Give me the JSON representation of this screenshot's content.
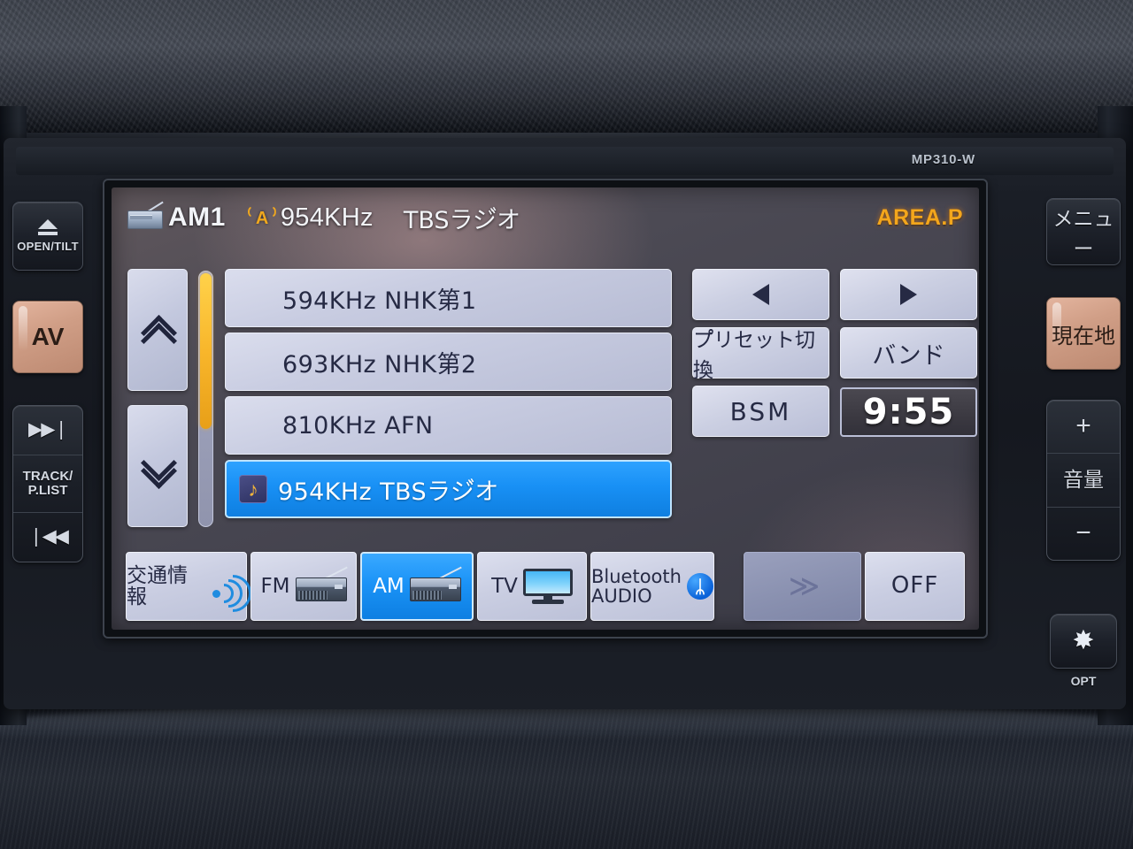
{
  "unit": {
    "model": "MP310-W"
  },
  "left_bezel": {
    "open_tilt": "OPEN/TILT",
    "av": "AV",
    "next_track": "▶▶❘",
    "track_plist_line1": "TRACK/",
    "track_plist_line2": "P.LIST",
    "prev_track": "❘◀◀"
  },
  "right_bezel": {
    "menu": "メニュー",
    "current_location": "現在地",
    "volume_up": "+",
    "volume_label": "音量",
    "volume_down": "−",
    "opt_label": "OPT",
    "opt_glyph": "✸"
  },
  "header": {
    "radio_icon": "radio-icon",
    "band": "AM1",
    "antenna_icon": "antenna-icon",
    "antenna_letter": "A",
    "frequency": "954KHz",
    "station": "TBSラジ゙オ",
    "area_preset": "AREA.P",
    "area_color": "#f3a61c"
  },
  "presets": {
    "scroll_up_icon": "chevron-up-icon",
    "scroll_down_icon": "chevron-down-icon",
    "items": [
      {
        "label": "594KHz  NHK第1",
        "selected": false
      },
      {
        "label": "693KHz  NHK第2",
        "selected": false
      },
      {
        "label": "810KHz  AFN",
        "selected": false
      },
      {
        "label": "954KHz  TBSラジ゙オ",
        "selected": true,
        "icon": "music-note-icon",
        "icon_glyph": "♪"
      }
    ]
  },
  "controls": {
    "prev_arrow": "◀",
    "next_arrow": "▶",
    "preset_switch": "プ゚リセット切換",
    "band": "バンド",
    "bsm": "BSM"
  },
  "clock": {
    "time": "9:55"
  },
  "source_bar": {
    "traffic": "交通情報",
    "fm": "FM",
    "am": "AM",
    "tv": "TV",
    "bluetooth_line1": "Bluetooth",
    "bluetooth_line2": "AUDIO",
    "bluetooth_glyph": "ᛦ",
    "more": "≫",
    "off": "OFF",
    "selected": "AM"
  },
  "colors": {
    "accent_blue": "#1b93f7",
    "button_face": "#cbcfe2",
    "screen_bg": "#4c4a54",
    "scroll_thumb": "#f8b62b",
    "bezel_tan": "#d09e86"
  }
}
